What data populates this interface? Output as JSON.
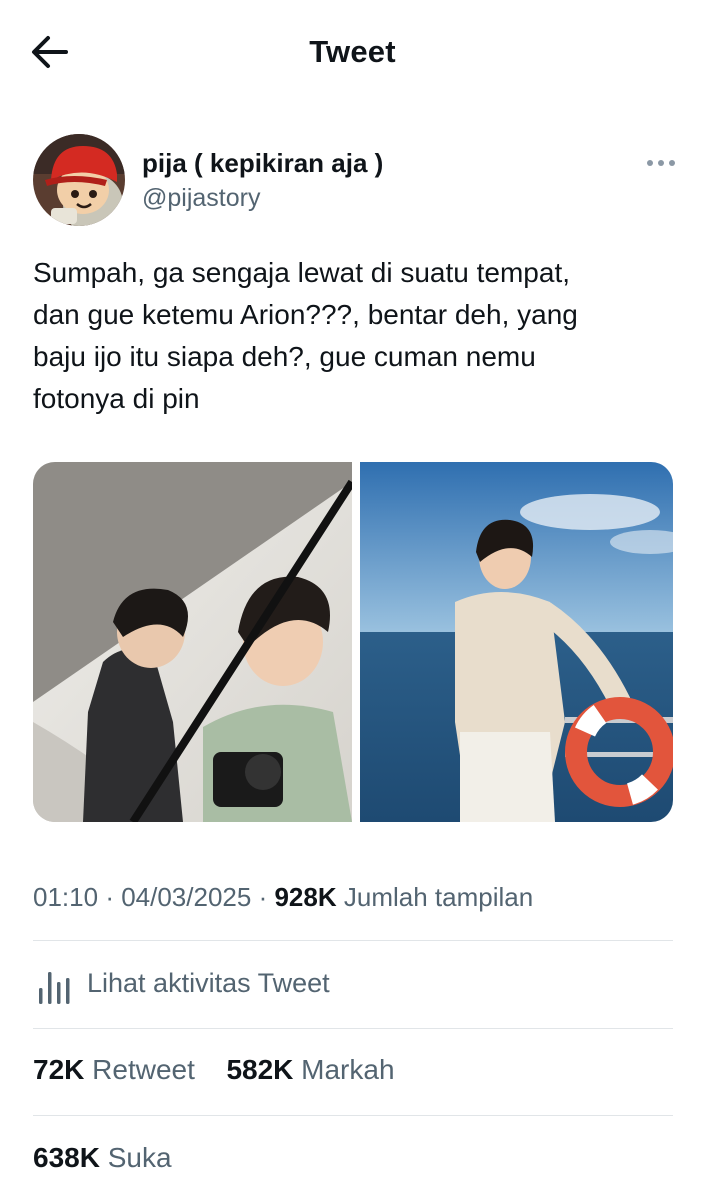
{
  "header": {
    "title": "Tweet",
    "back_icon": "arrow-left-icon"
  },
  "author": {
    "name": "pija ( kepikiran aja )",
    "handle": "@pijastory",
    "avatar": "avatar-cartoon-red-helmet",
    "more_icon": "more-horizontal-icon"
  },
  "tweet": {
    "text": "Sumpah, ga sengaja lewat di suatu tempat,\ndan gue ketemu Arion???, bentar deh, yang\nbaju ijo itu siapa deh?, gue cuman nemu\nfotonya di pin",
    "media": [
      "photo-two-men-studio-camera",
      "photo-man-on-boat-sea"
    ]
  },
  "meta": {
    "time": "01:10",
    "date": "04/03/2025",
    "views": "928K",
    "views_label": "Jumlah tampilan"
  },
  "activity": {
    "label": "Lihat aktivitas Tweet",
    "icon": "bar-chart-icon"
  },
  "stats": {
    "retweets": "72K",
    "retweets_label": "Retweet",
    "bookmarks": "582K",
    "bookmarks_label": "Markah",
    "likes": "638K",
    "likes_label": "Suka"
  },
  "colors": {
    "text": "#0f1419",
    "secondary": "#536471",
    "divider": "#e1e5e8"
  }
}
